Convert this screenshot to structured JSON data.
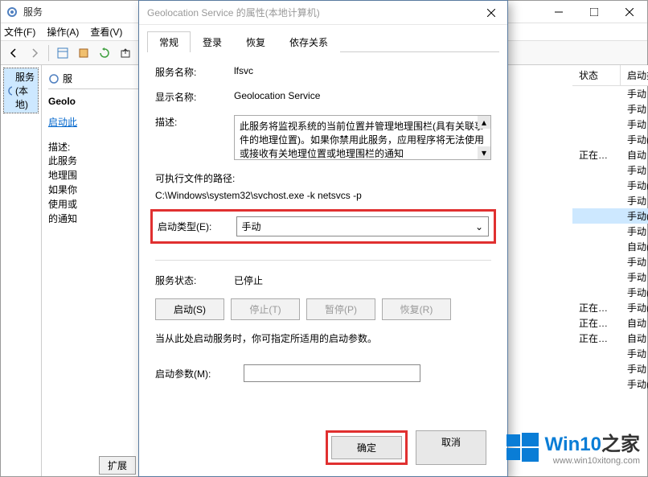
{
  "services_window": {
    "title": "服务",
    "menubar": {
      "file": "文件(F)",
      "operation": "操作(A)",
      "view": "查看(V)"
    },
    "tree_root": "服务(本地)",
    "list_panel_title": "服",
    "detail_name": "Geolo",
    "detail_link": "启动此",
    "detail_desc_label": "描述:",
    "detail_desc": "此服务\n地理围\n如果你\n使用或\n的通知",
    "columns": {
      "status": "状态",
      "startup": "启动类型"
    },
    "rows": [
      {
        "status": "",
        "startup": "手动"
      },
      {
        "status": "",
        "startup": "手动"
      },
      {
        "status": "",
        "startup": "手动"
      },
      {
        "status": "",
        "startup": "手动(触发…"
      },
      {
        "status": "正在…",
        "startup": "自动"
      },
      {
        "status": "",
        "startup": "手动"
      },
      {
        "status": "",
        "startup": "手动(触发…"
      },
      {
        "status": "",
        "startup": "手动"
      },
      {
        "status": "",
        "startup": "手动(触发…",
        "sel": true
      },
      {
        "status": "",
        "startup": "手动"
      },
      {
        "status": "",
        "startup": "自动(延迟…"
      },
      {
        "status": "",
        "startup": "手动"
      },
      {
        "status": "",
        "startup": "手动"
      },
      {
        "status": "",
        "startup": "手动(触发…"
      },
      {
        "status": "正在…",
        "startup": "手动(触发…"
      },
      {
        "status": "正在…",
        "startup": "自动"
      },
      {
        "status": "正在…",
        "startup": "自动"
      },
      {
        "status": "",
        "startup": "手动"
      },
      {
        "status": "",
        "startup": "手动"
      },
      {
        "status": "",
        "startup": "手动(触发…"
      }
    ],
    "bottom_tabs": {
      "extended": "扩展"
    }
  },
  "dialog": {
    "title": "Geolocation Service 的属性(本地计算机)",
    "tabs": {
      "general": "常规",
      "logon": "登录",
      "recovery": "恢复",
      "dependencies": "依存关系"
    },
    "service_name_label": "服务名称:",
    "service_name": "lfsvc",
    "display_name_label": "显示名称:",
    "display_name": "Geolocation Service",
    "description_label": "描述:",
    "description": "此服务将监视系统的当前位置并管理地理围栏(具有关联事件的地理位置)。如果你禁用此服务，应用程序将无法使用或接收有关地理位置或地理围栏的通知",
    "exe_path_label": "可执行文件的路径:",
    "exe_path": "C:\\Windows\\system32\\svchost.exe -k netsvcs -p",
    "startup_type_label": "启动类型(E):",
    "startup_type_value": "手动",
    "service_status_label": "服务状态:",
    "service_status": "已停止",
    "buttons": {
      "start": "启动(S)",
      "stop": "停止(T)",
      "pause": "暂停(P)",
      "resume": "恢复(R)"
    },
    "note": "当从此处启动服务时，你可指定所适用的启动参数。",
    "params_label": "启动参数(M):",
    "ok": "确定",
    "cancel": "取消"
  },
  "watermark": {
    "text_main": "Win10",
    "text_suffix": "之家",
    "url": "www.win10xitong.com"
  }
}
